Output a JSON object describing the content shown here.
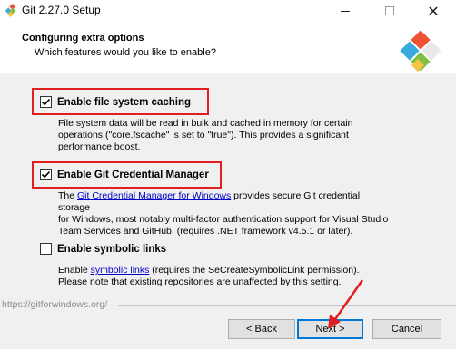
{
  "window": {
    "title": "Git 2.27.0 Setup"
  },
  "header": {
    "title": "Configuring extra options",
    "subtitle": "Which features would you like to enable?"
  },
  "options": {
    "fs_cache": {
      "label": "Enable file system caching",
      "checked": true,
      "desc_line1": "File system data will be read in bulk and cached in memory for certain",
      "desc_line2": "operations (\"core.fscache\" is set to \"true\"). This provides a significant",
      "desc_line3": "performance boost."
    },
    "credential": {
      "label": "Enable Git Credential Manager",
      "checked": true,
      "desc_prefix": "The ",
      "desc_link": "Git Credential Manager for Windows",
      "desc_suffix": " provides secure Git credential storage",
      "desc_line2": "for Windows, most notably multi-factor authentication support for Visual Studio",
      "desc_line3": "Team Services and GitHub. (requires .NET framework v4.5.1 or later)."
    },
    "symlinks": {
      "label": "Enable symbolic links",
      "checked": false,
      "desc_prefix": "Enable ",
      "desc_link": "symbolic links",
      "desc_suffix": " (requires the SeCreateSymbolicLink permission).",
      "desc_line2": "Please note that existing repositories are unaffected by this setting."
    }
  },
  "footer": {
    "url": "https://gitforwindows.org/",
    "back_label": "< Back",
    "next_label": "Next >",
    "cancel_label": "Cancel"
  },
  "colors": {
    "highlight": "#e02020",
    "link": "#0000cc",
    "accent": "#0078d7"
  }
}
